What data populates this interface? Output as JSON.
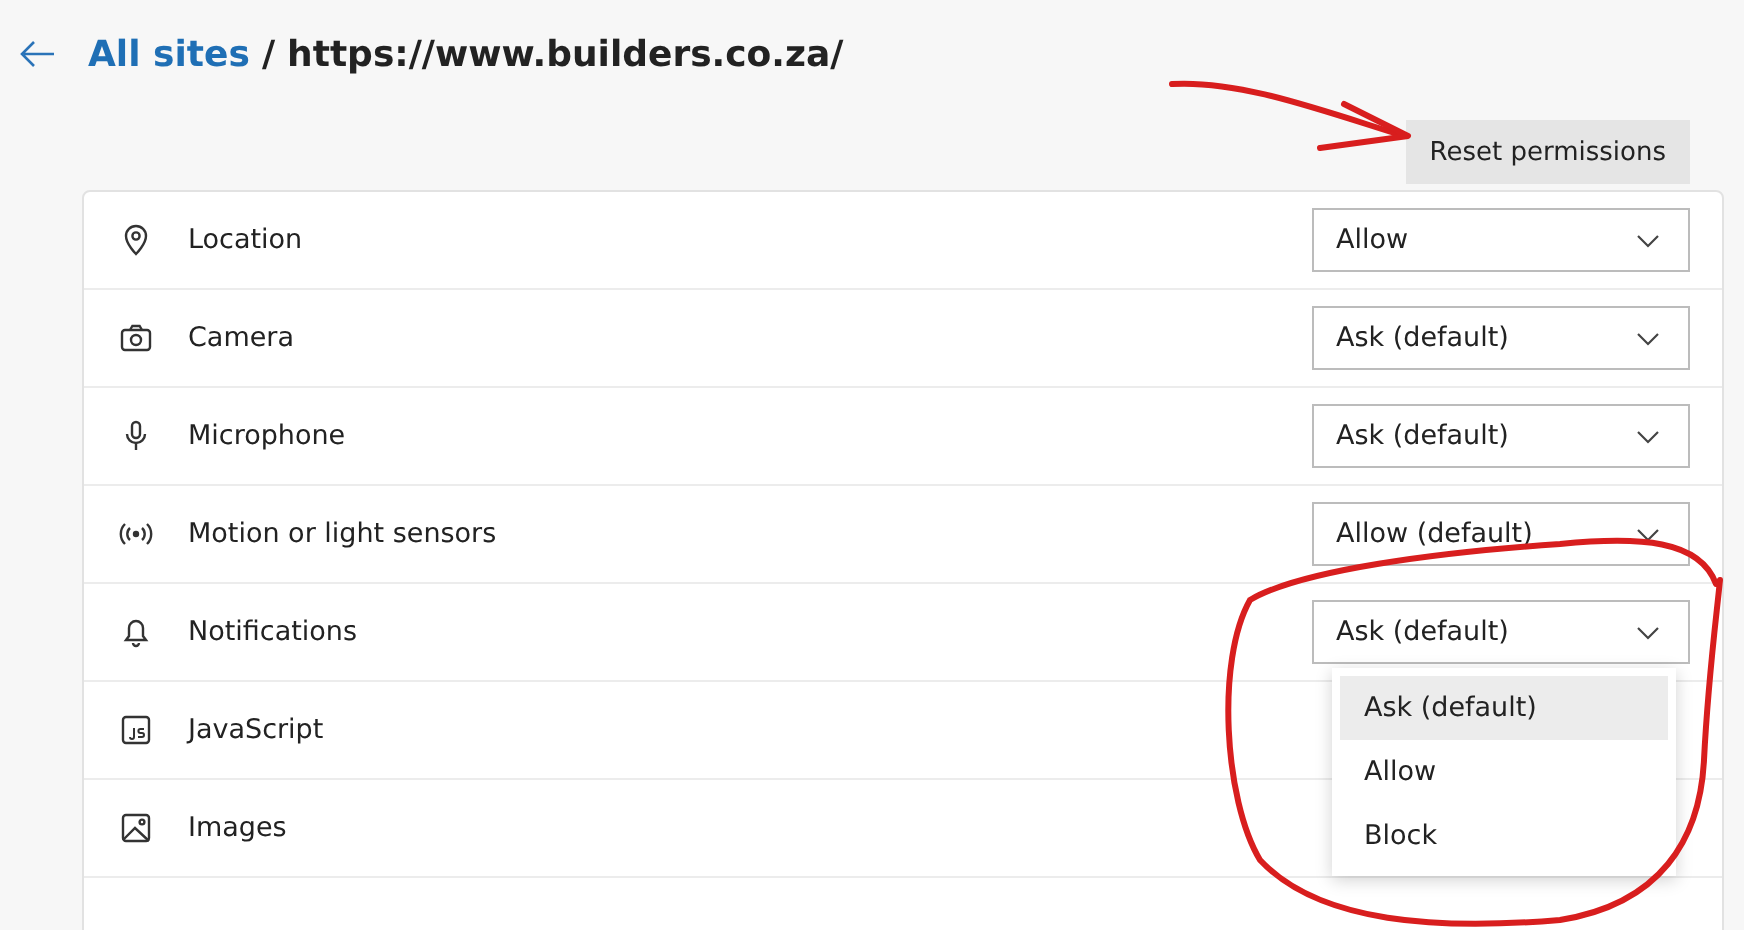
{
  "breadcrumb": {
    "link": "All sites",
    "separator": "/",
    "current": "https://www.builders.co.za/"
  },
  "reset_button": "Reset permissions",
  "permissions": [
    {
      "label": "Location",
      "value": "Allow"
    },
    {
      "label": "Camera",
      "value": "Ask (default)"
    },
    {
      "label": "Microphone",
      "value": "Ask (default)"
    },
    {
      "label": "Motion or light sensors",
      "value": "Allow (default)"
    },
    {
      "label": "Notifications",
      "value": "Ask (default)",
      "options": [
        {
          "label": "Ask (default)",
          "selected": true
        },
        {
          "label": "Allow",
          "selected": false
        },
        {
          "label": "Block",
          "selected": false
        }
      ]
    },
    {
      "label": "JavaScript"
    },
    {
      "label": "Images"
    }
  ]
}
